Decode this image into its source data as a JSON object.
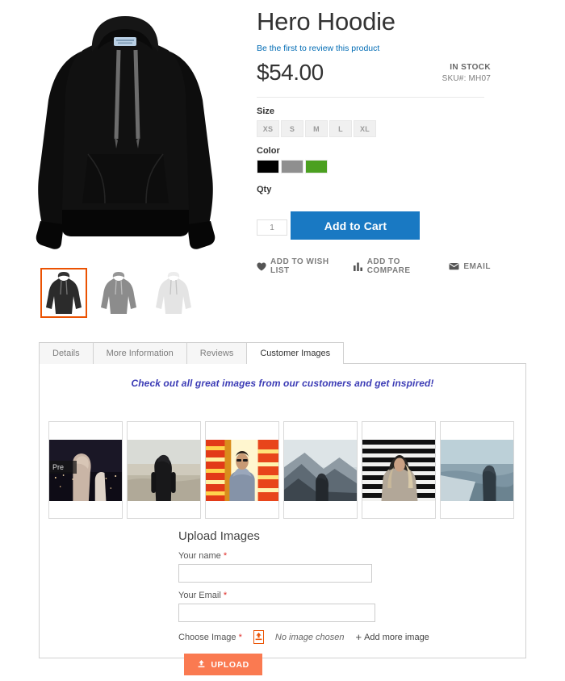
{
  "product": {
    "title": "Hero Hoodie",
    "review_link": "Be the first to review this product",
    "price": "$54.00",
    "stock_status": "IN STOCK",
    "sku": "SKU#:  MH07",
    "size_label": "Size",
    "sizes": [
      "XS",
      "S",
      "M",
      "L",
      "XL"
    ],
    "color_label": "Color",
    "colors": [
      {
        "name": "black",
        "hex": "#000000"
      },
      {
        "name": "gray",
        "hex": "#8f8f8f"
      },
      {
        "name": "green",
        "hex": "#4ba020"
      }
    ],
    "qty_label": "Qty",
    "qty_value": "1",
    "add_to_cart": "Add to Cart",
    "accent_button_color": "#1979c3",
    "actions": [
      {
        "icon": "heart-icon",
        "label": "ADD TO WISH LIST"
      },
      {
        "icon": "bar-chart-icon",
        "label": "ADD TO COMPARE"
      },
      {
        "icon": "envelope-icon",
        "label": "EMAIL"
      }
    ],
    "thumbnails": [
      {
        "name": "thumb-black-hoodie",
        "color": "#232323",
        "active": true
      },
      {
        "name": "thumb-gray-hoodie",
        "color": "#8c8c8c",
        "active": false
      },
      {
        "name": "thumb-white-hoodie",
        "color": "#e2e2e2",
        "active": false
      }
    ]
  },
  "tabs": [
    {
      "label": "Details",
      "active": false
    },
    {
      "label": "More Information",
      "active": false
    },
    {
      "label": "Reviews",
      "active": false
    },
    {
      "label": "Customer Images",
      "active": true
    }
  ],
  "customer_images": {
    "heading": "Check out all great images from our customers and get inspired!",
    "heading_color": "#3b3bb5",
    "prev_button": "Pre",
    "slides": [
      {
        "name": "customer-image-1",
        "alt": "person in beige hoodie overlooking city at night"
      },
      {
        "name": "customer-image-2",
        "alt": "person in black hoodie on open plain"
      },
      {
        "name": "customer-image-3",
        "alt": "man in hoodie under neon lights"
      },
      {
        "name": "customer-image-4",
        "alt": "silhouette in hoodie in foggy mountains"
      },
      {
        "name": "customer-image-5",
        "alt": "person in hoodie against striped wall"
      },
      {
        "name": "customer-image-6",
        "alt": "person in hoodie on misty shoreline"
      }
    ]
  },
  "upload_form": {
    "title": "Upload Images",
    "name_label": "Your name",
    "name_value": "",
    "email_label": "Your Email",
    "email_value": "",
    "choose_label": "Choose Image",
    "file_status": "No image chosen",
    "add_more": "Add more image",
    "upload_button": "UPLOAD",
    "required_mark": "*",
    "accent_color": "#fa7a51",
    "file_border_color": "#eb5202"
  }
}
